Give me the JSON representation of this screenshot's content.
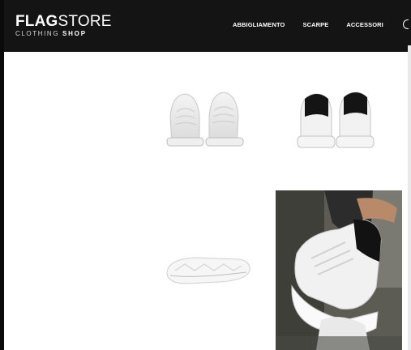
{
  "header": {
    "logo": {
      "brand_part1": "FLAG",
      "brand_part2": "STORE",
      "tagline_part1": "CLOTHING",
      "tagline_part2": "SHOP"
    },
    "nav": {
      "items": [
        {
          "label": "ABBIGLIAMENTO"
        },
        {
          "label": "SCARPE"
        },
        {
          "label": "ACCESSORI"
        }
      ]
    },
    "colors": {
      "header_bg": "#141414",
      "text": "#ffffff"
    }
  },
  "products": [
    {
      "image": "white-sneakers-front-pair"
    },
    {
      "image": "white-sneakers-black-heel-back-pair"
    },
    {
      "image": "sneaker-sole-side"
    },
    {
      "image": "photo-person-wearing-white-sneakers-black-heel"
    }
  ]
}
